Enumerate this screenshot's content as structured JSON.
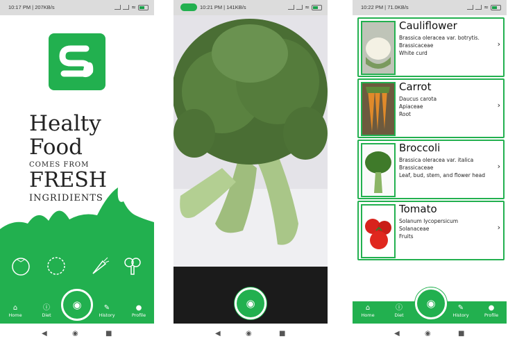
{
  "phone1": {
    "status": {
      "time": "10:17 PM | 207KB/s"
    },
    "headline": {
      "line1": "Healty",
      "line2": "Food",
      "line3": "COMES FROM",
      "line4": "FRESH",
      "line5": "INGRIDIENTS"
    },
    "veg_icons": [
      "tomato-icon",
      "cauliflower-icon",
      "carrot-icon",
      "broccoli-icon"
    ],
    "tabs": [
      {
        "label": "Home",
        "icon": "home-icon"
      },
      {
        "label": "Diet",
        "icon": "info-icon"
      },
      {
        "label": "History",
        "icon": "pencil-icon"
      },
      {
        "label": "Profile",
        "icon": "user-icon"
      }
    ]
  },
  "phone2": {
    "status": {
      "time": "10:21 PM | 141KB/s"
    }
  },
  "phone3": {
    "status": {
      "time": "10:22 PM | 71.0KB/s"
    },
    "items": [
      {
        "name": "Cauliflower",
        "species": "Brassica oleracea var. botrytis.",
        "family": "Brassicaceae",
        "part": "White curd"
      },
      {
        "name": "Carrot",
        "species": "Daucus carota",
        "family": "Apiaceae",
        "part": "Root"
      },
      {
        "name": "Broccoli",
        "species": "Brassica oleracea var. italica",
        "family": "Brassicaceae",
        "part": "Leaf, bud, stem, and flower head"
      },
      {
        "name": "Tomato",
        "species": "Solanum lycopersicum",
        "family": "Solanaceae",
        "part": "Fruits"
      }
    ],
    "tabs": [
      {
        "label": "Home",
        "icon": "home-icon"
      },
      {
        "label": "Diet",
        "icon": "info-icon"
      },
      {
        "label": "History",
        "icon": "pencil-icon"
      },
      {
        "label": "Profile",
        "icon": "user-icon"
      }
    ]
  },
  "colors": {
    "brand_green": "#22b04f"
  }
}
